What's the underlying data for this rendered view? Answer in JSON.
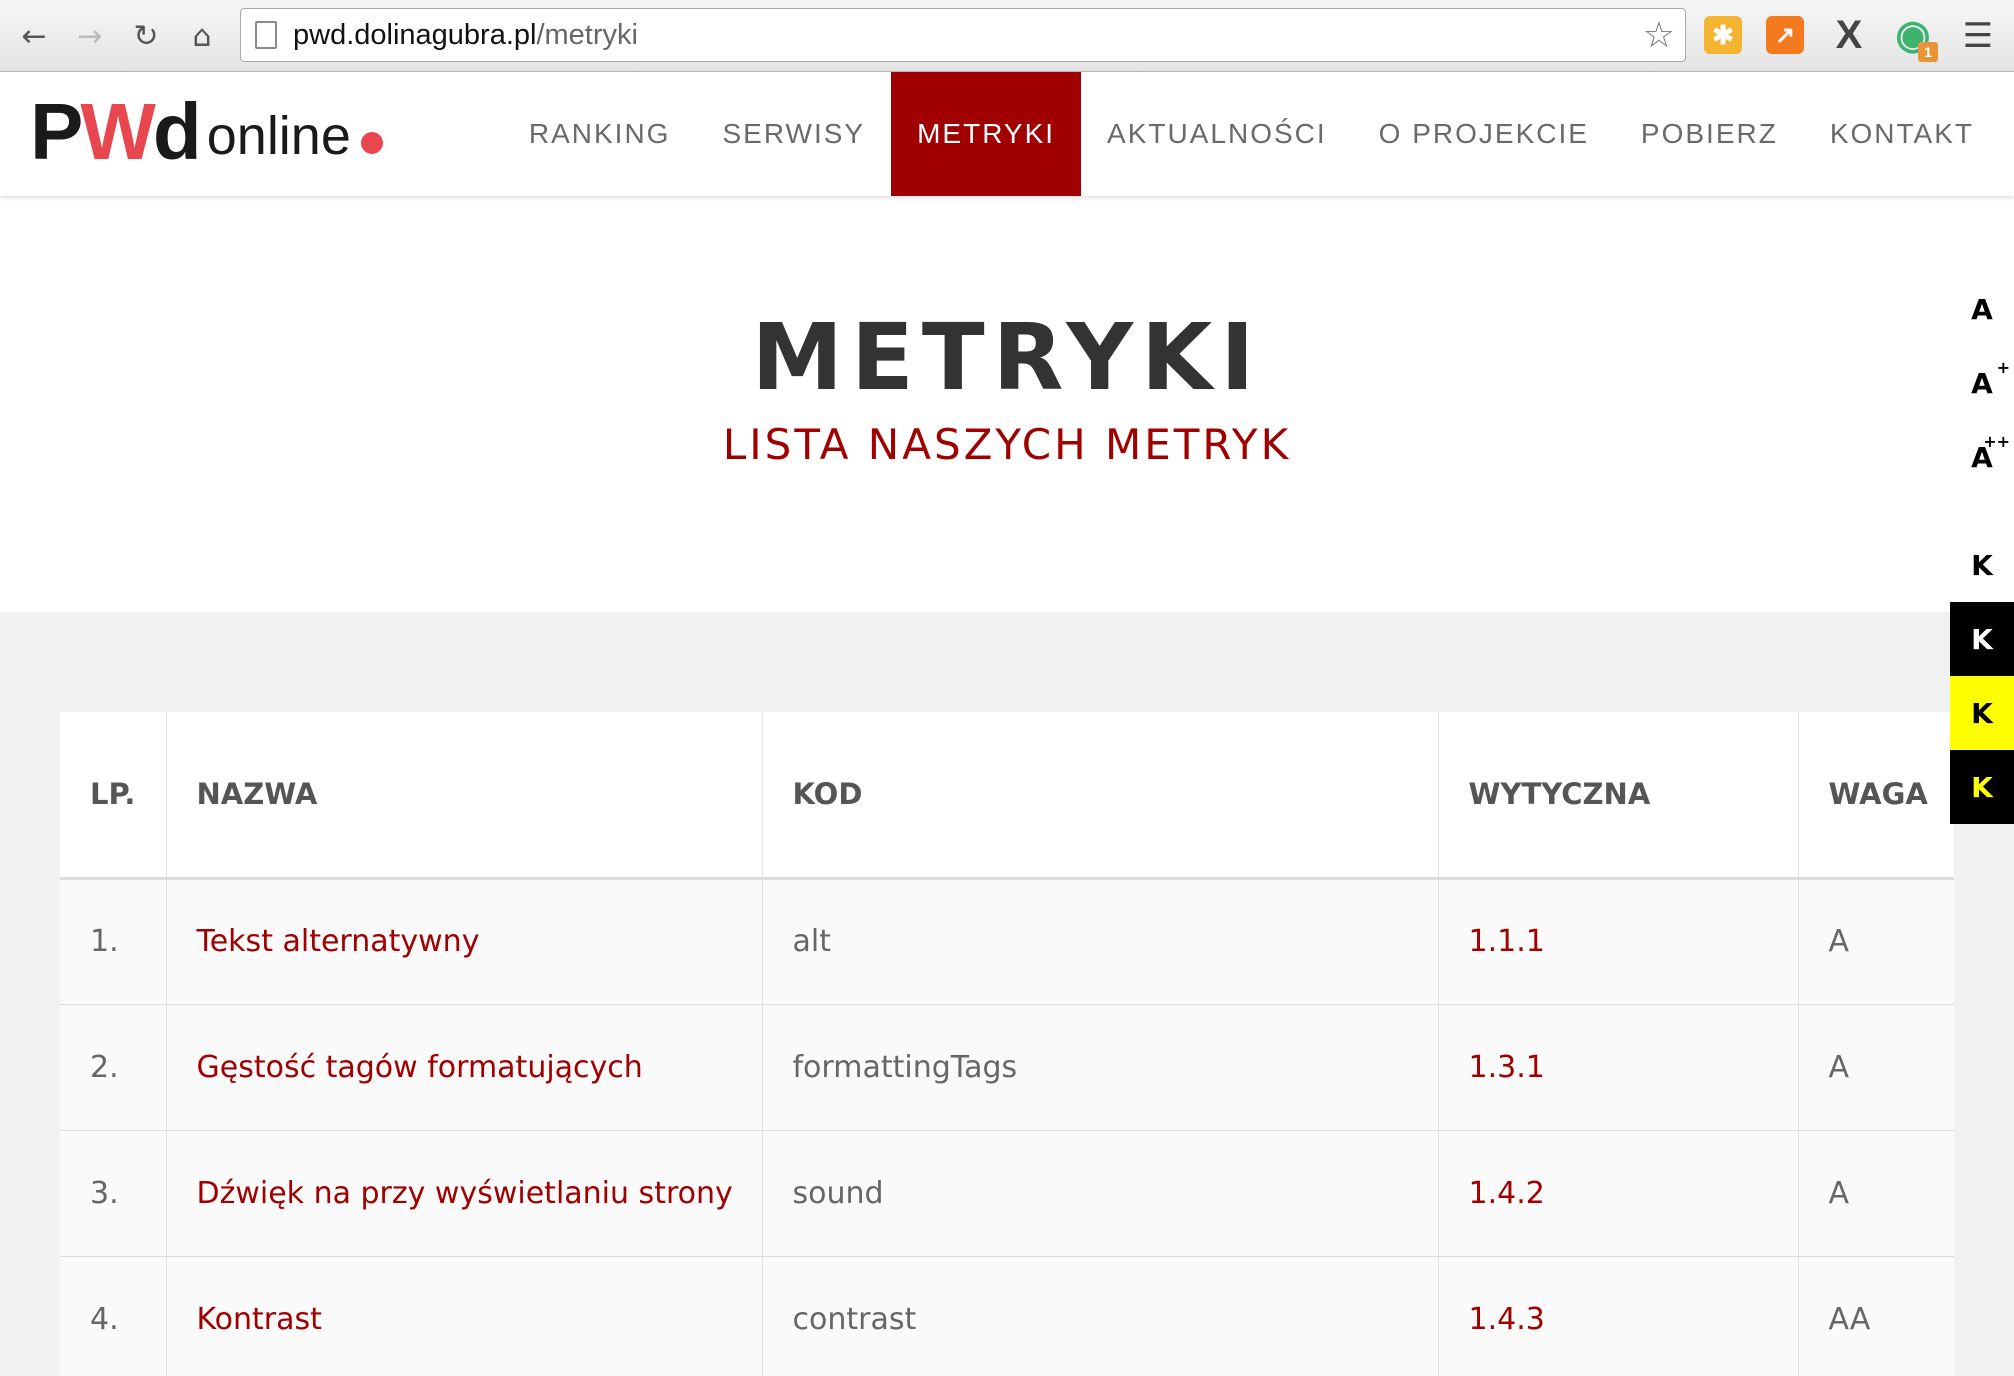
{
  "browser": {
    "url_host": "pwd.dolinagubra.pl",
    "url_path": "/metryki",
    "extension_badge": "1"
  },
  "site": {
    "logo_letters": [
      "P",
      "W",
      "d"
    ],
    "logo_text": "online",
    "nav": [
      {
        "label": "RANKING",
        "active": false
      },
      {
        "label": "SERWISY",
        "active": false
      },
      {
        "label": "METRYKI",
        "active": true
      },
      {
        "label": "AKTUALNOŚCI",
        "active": false
      },
      {
        "label": "O PROJEKCIE",
        "active": false
      },
      {
        "label": "POBIERZ",
        "active": false
      },
      {
        "label": "KONTAKT",
        "active": false
      }
    ]
  },
  "hero": {
    "title": "METRYKI",
    "subtitle": "LISTA NASZYCH METRYK"
  },
  "accessibility": {
    "font_sizes": [
      {
        "label": "A",
        "sup": ""
      },
      {
        "label": "A",
        "sup": "+"
      },
      {
        "label": "A",
        "sup": "++"
      }
    ],
    "contrast": [
      {
        "label": "K",
        "scheme": "default"
      },
      {
        "label": "K",
        "scheme": "white-on-black"
      },
      {
        "label": "K",
        "scheme": "black-on-yellow"
      },
      {
        "label": "K",
        "scheme": "yellow-on-black"
      }
    ]
  },
  "table": {
    "headers": [
      "LP.",
      "NAZWA",
      "KOD",
      "WYTYCZNA",
      "WAGA"
    ],
    "rows": [
      {
        "lp": "1.",
        "nazwa": "Tekst alternatywny",
        "kod": "alt",
        "wytyczna": "1.1.1",
        "waga": "A"
      },
      {
        "lp": "2.",
        "nazwa": "Gęstość tagów formatujących",
        "kod": "formattingTags",
        "wytyczna": "1.3.1",
        "waga": "A"
      },
      {
        "lp": "3.",
        "nazwa": "Dźwięk na przy wyświetlaniu strony",
        "kod": "sound",
        "wytyczna": "1.4.2",
        "waga": "A"
      },
      {
        "lp": "4.",
        "nazwa": "Kontrast",
        "kod": "contrast",
        "wytyczna": "1.4.3",
        "waga": "AA"
      }
    ]
  },
  "colors": {
    "accent": "#a00000",
    "logo_red": "#e8474f",
    "page_bg": "#f1f1f1"
  }
}
